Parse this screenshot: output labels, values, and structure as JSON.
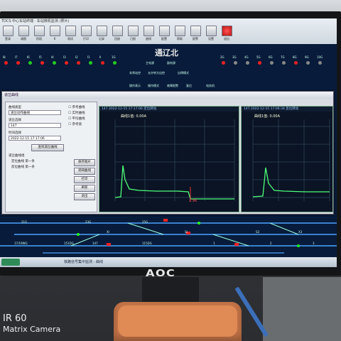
{
  "window_title": "TDCS 中心车站终端 · 车站微机监测 (照片)",
  "toolbar": {
    "buttons": [
      "登录",
      "调图",
      "阶段",
      "K",
      "测试",
      "打印",
      "记录",
      "回放",
      "日报",
      "曲线",
      "配置",
      "帮助",
      "报警",
      "设置",
      "退出"
    ]
  },
  "station": {
    "name": "通辽北",
    "top_labels": [
      "主电源",
      "副电源",
      "非常站控",
      "允许转方自控",
      "自律模式",
      "操作表示",
      "操作模式",
      "故障报警",
      "复位",
      "电务机"
    ],
    "signal_labels": [
      "I8",
      "I7",
      "I6",
      "I5",
      "I4",
      "I3",
      "I2",
      "I1",
      "II",
      "1G",
      "2G",
      "3G",
      "4G",
      "5G",
      "6G",
      "7G",
      "8G",
      "9G",
      "10G"
    ]
  },
  "dialog": {
    "title": "道岔曲线",
    "form": {
      "type_label": "曲线类型",
      "type_value": "道岔动作曲线",
      "switch_label": "道岔选择",
      "switch_value": "147",
      "time_label": "时间选择",
      "time_value": "2022-12-15 17:17:06",
      "find_button": "查找道岔曲线",
      "group_label": "道岔曲线组",
      "rows": [
        "定位曲线 第一条",
        "反位曲线 第一条"
      ],
      "checkboxes": [
        "参考曲线",
        "实时曲线",
        "平均曲线",
        "参考值"
      ],
      "buttons": [
        "保存图片",
        "调阅曲线",
        "打印",
        "刷新",
        "退出"
      ]
    },
    "plot_left": {
      "header": "147  2022-12-15 17:17:06  定位转动",
      "sub": "曲线1值: 0.00A",
      "end_label": "2.96"
    },
    "plot_right": {
      "header": "147  2022-12-15 17:06:34  反位转动",
      "sub": "曲线1值: 0.00A"
    }
  },
  "track_labels": [
    "21G",
    "23G",
    "25G",
    "XI",
    "SI",
    "S3",
    "X3",
    "17/19WG",
    "151DG",
    "147",
    "115DG",
    "1",
    "2",
    "3"
  ],
  "taskbar": {
    "label": "铁路信号集中监测 - 曲线"
  },
  "monitor_brand": "AOC",
  "watermark": {
    "line1": "IR 60",
    "line2": "Matrix Camera"
  },
  "colors": {
    "curve": "#4dff7a",
    "screen_bg": "#081b3a",
    "desk_base": "#e08a55"
  }
}
